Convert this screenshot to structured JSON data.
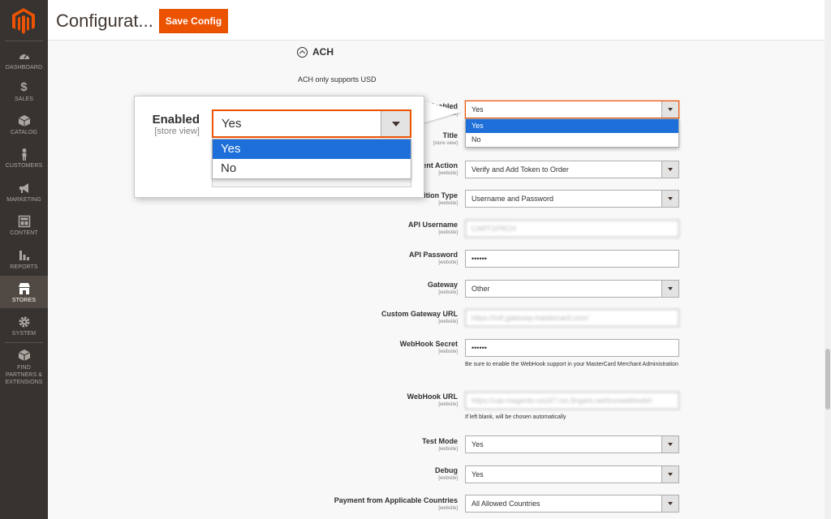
{
  "header": {
    "title": "Configurat...",
    "save_label": "Save Config"
  },
  "sidebar": {
    "items": [
      {
        "label": "DASHBOARD",
        "icon": "dashboard-icon"
      },
      {
        "label": "SALES",
        "icon": "dollar-icon"
      },
      {
        "label": "CATALOG",
        "icon": "cube-icon"
      },
      {
        "label": "CUSTOMERS",
        "icon": "person-icon"
      },
      {
        "label": "MARKETING",
        "icon": "megaphone-icon"
      },
      {
        "label": "CONTENT",
        "icon": "layout-icon"
      },
      {
        "label": "REPORTS",
        "icon": "bar-chart-icon"
      },
      {
        "label": "STORES",
        "icon": "storefront-icon",
        "active": true
      },
      {
        "label": "SYSTEM",
        "icon": "gear-icon"
      },
      {
        "label": "FIND PARTNERS & EXTENSIONS",
        "icon": "box-icon"
      }
    ]
  },
  "section": {
    "title": "ACH",
    "note": "ACH only supports USD"
  },
  "fields": {
    "enabled": {
      "label": "Enabled",
      "scope": "[store view]",
      "value": "Yes",
      "options": [
        "Yes",
        "No"
      ]
    },
    "title": {
      "label": "Title",
      "scope": "[store view]"
    },
    "payment_action": {
      "label": "ent Action",
      "scope": "[website]",
      "value": "Verify and Add Token to Order"
    },
    "auth_type": {
      "label": "ition Type",
      "scope": "[website]",
      "value": "Username and Password"
    },
    "api_username": {
      "label": "API Username",
      "scope": "[website]",
      "value": "CART1PRCH"
    },
    "api_password": {
      "label": "API Password",
      "scope": "[website]",
      "value": "••••••"
    },
    "gateway": {
      "label": "Gateway",
      "scope": "[website]",
      "value": "Other"
    },
    "custom_gateway_url": {
      "label": "Custom Gateway URL",
      "scope": "[website]",
      "value": "https://mtf.gateway.mastercard.com/"
    },
    "webhook_secret": {
      "label": "WebHook Secret",
      "scope": "[website]",
      "value": "••••••",
      "hint": "Be sure to enable the WebHook support in your MasterCard Merchant Administration"
    },
    "webhook_url": {
      "label": "WebHook URL",
      "scope": "[website]",
      "value": "https://uat-magento-ce247-mc.fingent.net/tns/webhook/r",
      "hint": "If left blank, will be chosen automatically"
    },
    "test_mode": {
      "label": "Test Mode",
      "scope": "[website]",
      "value": "Yes"
    },
    "debug": {
      "label": "Debug",
      "scope": "[website]",
      "value": "Yes"
    },
    "countries": {
      "label": "Payment from Applicable Countries",
      "scope": "[website]",
      "value": "All Allowed Countries"
    }
  },
  "callout": {
    "label": "Enabled",
    "scope": "[store view]",
    "value": "Yes",
    "options": [
      "Yes",
      "No"
    ]
  }
}
